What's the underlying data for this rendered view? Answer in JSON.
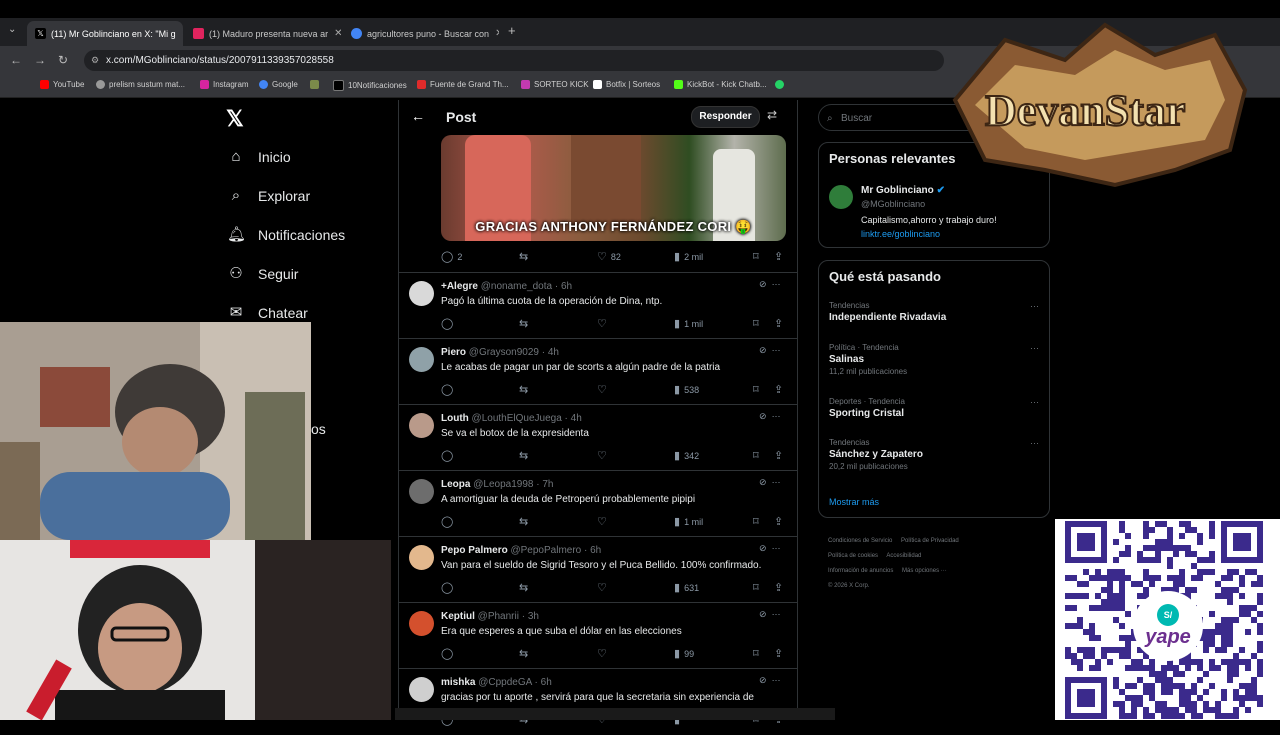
{
  "browser": {
    "tabs": [
      {
        "label": "(11) Mr Goblinciano en X: \"Mi g",
        "active": true
      },
      {
        "label": "(1) Maduro presenta nueva ar",
        "active": false
      },
      {
        "label": "agricultores puno - Buscar con",
        "active": false
      }
    ],
    "url": "x.com/MGoblinciano/status/2007911339357028558",
    "bookmarks": [
      "YouTube",
      "prelism sustum mat...",
      "Instagram",
      "Google",
      "10Notificaciones",
      "Fuente de Grand Th...",
      "SORTEO KICK",
      "Botfix | Sorteos",
      "KickBot - Kick Chatb..."
    ]
  },
  "nav": {
    "items": [
      {
        "label": "Inicio",
        "icon": "home-icon"
      },
      {
        "label": "Explorar",
        "icon": "search-icon"
      },
      {
        "label": "Notificaciones",
        "icon": "bell-icon"
      },
      {
        "label": "Seguir",
        "icon": "follow-icon"
      },
      {
        "label": "Chatear",
        "icon": "mail-icon"
      }
    ],
    "partial_label": "os"
  },
  "post": {
    "header": "Post",
    "reply_button": "Responder",
    "media_caption": "GRACIAS ANTHONY FERNÁNDEZ CORI 🤑",
    "stats": {
      "replies": "2",
      "likes": "82",
      "views": "2 mil"
    }
  },
  "replies": [
    {
      "name": "+Alegre",
      "handle": "@noname_dota · 6h",
      "text": "Pagó la última cuota de la operación de Dina, ntp.",
      "views": "1 mil",
      "avatar_color": "#d9d9d9"
    },
    {
      "name": "Piero",
      "handle": "@Grayson9029 · 4h",
      "text": "Le acabas de pagar un par de scorts a algún padre de la patria",
      "views": "538",
      "avatar_color": "#8fa1a8"
    },
    {
      "name": "Louth",
      "handle": "@LouthElQueJuega · 4h",
      "text": "Se va el botox de la expresidenta",
      "views": "342",
      "avatar_color": "#b99a8a"
    },
    {
      "name": "Leopa",
      "handle": "@Leopa1998 · 7h",
      "text": "A amortiguar la deuda de Petroperú probablemente pipipi",
      "views": "1 mil",
      "avatar_color": "#6d6d6d"
    },
    {
      "name": "Pepo Palmero",
      "handle": "@PepoPalmero · 6h",
      "text": "Van para el sueldo de Sigrid Tesoro y el Puca Bellido. 100% confirmado.",
      "views": "631",
      "avatar_color": "#e3b88d"
    },
    {
      "name": "Keptiul",
      "handle": "@Phanrii · 3h",
      "text": "Era que esperes a que suba el dólar en las elecciones",
      "views": "99",
      "avatar_color": "#d4502d"
    },
    {
      "name": "mishka",
      "handle": "@CppdeGA · 6h",
      "text": "gracias por tu aporte , servirá para que la secretaria sin experiencia de",
      "views": "",
      "avatar_color": "#cfcfcf"
    }
  ],
  "sidebar": {
    "search_placeholder": "Buscar",
    "relevant_title": "Personas relevantes",
    "relevant_person": {
      "name": "Mr Goblinciano",
      "handle": "@MGoblinciano",
      "bio": "Capitalismo,ahorro y trabajo duro!",
      "link": "linktr.ee/goblinciano"
    },
    "trending_title": "Qué está pasando",
    "trends": [
      {
        "category": "Tendencias",
        "name": "Independiente Rivadavia",
        "count": ""
      },
      {
        "category": "Política · Tendencia",
        "name": "Salinas",
        "count": "11,2 mil publicaciones"
      },
      {
        "category": "Deportes · Tendencia",
        "name": "Sporting Cristal",
        "count": ""
      },
      {
        "category": "Tendencias",
        "name": "Sánchez y Zapatero",
        "count": "20,2 mil publicaciones"
      }
    ],
    "show_more": "Mostrar más",
    "footer": [
      "Condiciones de Servicio",
      "Política de Privacidad",
      "Política de cookies",
      "Accesibilidad",
      "Información de anuncios",
      "Más opciones ···",
      "© 2026 X Corp."
    ]
  },
  "overlay": {
    "logo_text": "DevanStar",
    "qr_brand": "yape",
    "qr_symbol": "S/"
  },
  "colors": {
    "accent": "#1d9bf0",
    "background": "#000000",
    "border": "#2f3336",
    "muted": "#71767b"
  }
}
